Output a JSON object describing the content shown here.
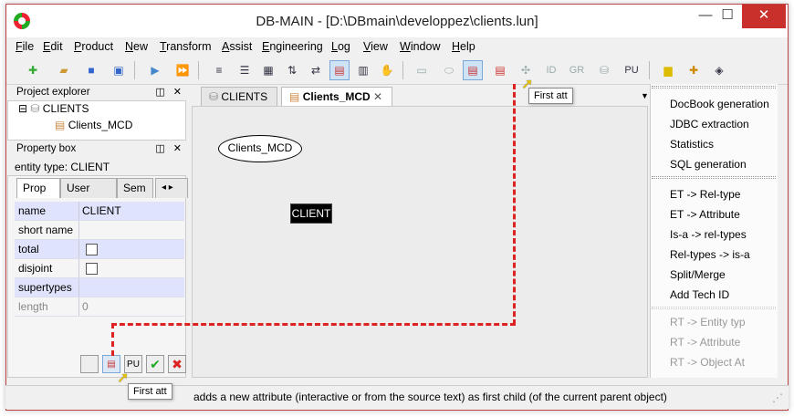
{
  "window": {
    "title": "DB-MAIN  - [D:\\DBmain\\developpez\\clients.lun]",
    "min": "—",
    "max": "☐",
    "close": "✕"
  },
  "menu": [
    "File",
    "Edit",
    "Product",
    "New",
    "Transform",
    "Assist",
    "Engineering",
    "Log",
    "View",
    "Window",
    "Help"
  ],
  "toolbar": {
    "icons": [
      "new-icon",
      "open-icon",
      "save-icon",
      "save-all-icon",
      "play-icon",
      "fast-forward-icon",
      "align-left-icon",
      "align-justify-icon",
      "grid-icon",
      "sort-icon",
      "swap-icon",
      "entity-tool-icon",
      "attribute-tool-icon",
      "hand-icon",
      "entity-icon",
      "relation-icon",
      "first-att-icon",
      "next-att-icon",
      "link-icon",
      "id-icon",
      "gr-icon",
      "collection-icon",
      "pu-icon",
      "note-icon",
      "group-icon",
      "paint-icon"
    ],
    "id_label": "ID",
    "gr_label": "GR",
    "pu_label": "PU"
  },
  "tooltip_top": "First att",
  "explorer": {
    "header": "Project explorer",
    "controls": "◫ ✕",
    "items": [
      "CLIENTS",
      "Clients_MCD"
    ]
  },
  "propbox": {
    "header": "Property box",
    "controls": "◫ ✕",
    "entity_type": "entity type: CLIENT",
    "tabs": [
      "Prop",
      "User prop",
      "Sem"
    ],
    "tab_arrows": "◂ ▸",
    "rows": [
      {
        "key": "name",
        "value": "CLIENT"
      },
      {
        "key": "short name",
        "value": ""
      },
      {
        "key": "total",
        "value": ""
      },
      {
        "key": "disjoint",
        "value": ""
      },
      {
        "key": "supertypes",
        "value": ""
      },
      {
        "key": "length",
        "value": "0"
      }
    ],
    "bottom_buttons": {
      "pu": "PU",
      "ok": "✔",
      "cancel": "✖"
    }
  },
  "doc_tabs": [
    "CLIENTS",
    "Clients_MCD"
  ],
  "doc_tab_close": "✕",
  "doc_tab_menu": "▼",
  "diagram": {
    "schema_label": "Clients_MCD",
    "entity_label": "CLIENT"
  },
  "right_panel": {
    "group1": [
      "DocBook generation",
      "JDBC extraction",
      "Statistics",
      "SQL generation"
    ],
    "group2": [
      "ET -> Rel-type",
      "ET -> Attribute",
      "Is-a -> rel-types",
      "Rel-types -> is-a",
      "Split/Merge",
      "Add Tech ID"
    ],
    "group3": [
      "RT -> Entity typ",
      "RT -> Attribute",
      "RT -> Object At"
    ]
  },
  "status": {
    "tooltip": "First att",
    "text": "adds a new attribute (interactive or from the source text) as first child (of the current parent object)",
    "grip": "⋰"
  },
  "colors": {
    "accent_red": "#d22222",
    "selection_blue": "#dfe3fb",
    "close_red": "#c9302c"
  }
}
